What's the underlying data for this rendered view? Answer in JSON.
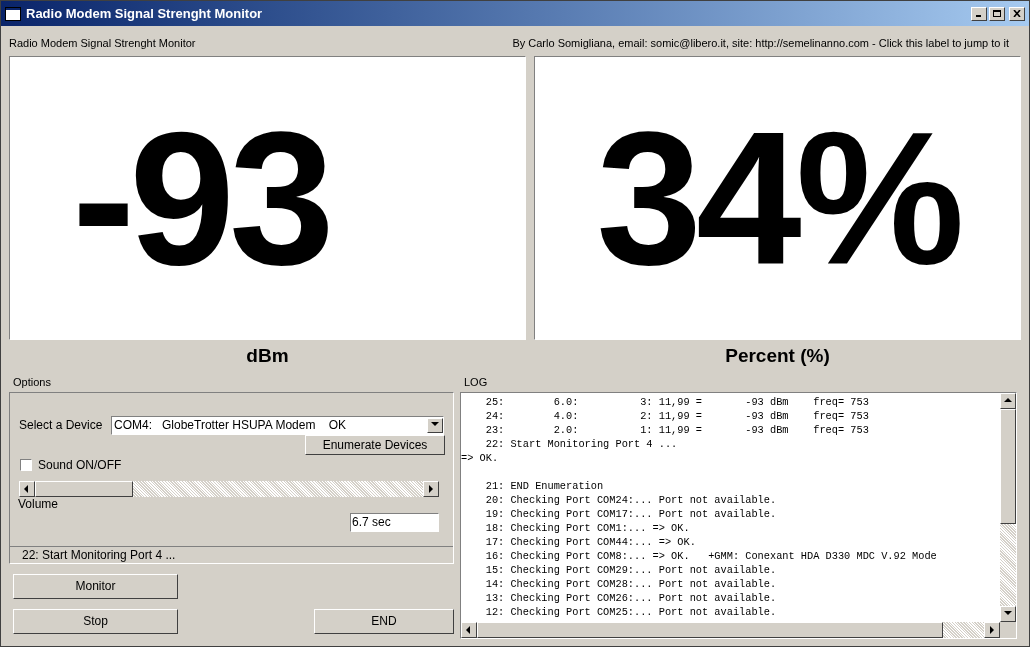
{
  "window": {
    "title": "Radio Modem Signal Strenght Monitor"
  },
  "header": {
    "app_label": "Radio Modem Signal Strenght Monitor",
    "credits_link": "By Carlo Somigliana, email: somic@libero.it, site: http://semelinanno.com - Click this label to jump to it"
  },
  "readouts": [
    {
      "value": "-93",
      "unit": "dBm"
    },
    {
      "value": "34%",
      "unit": "Percent (%)"
    }
  ],
  "options": {
    "title": "Options",
    "device_label": "Select a Device",
    "device_value": "COM4:   GlobeTrotter HSUPA Modem    OK",
    "enumerate_button": "Enumerate Devices",
    "sound": {
      "label": "Sound ON/OFF",
      "checked": false
    },
    "volume": {
      "label": "Volume",
      "level": 0
    },
    "interval": "6.7 sec",
    "status": "22: Start Monitoring Port 4 ..."
  },
  "buttons": {
    "monitor": "Monitor",
    "stop": "Stop",
    "end": "END"
  },
  "log": {
    "title": "LOG",
    "blocks": [
      [
        "    25:        6.0:          3: 11,99 =       -93 dBm    freq= 753",
        "    24:        4.0:          2: 11,99 =       -93 dBm    freq= 753",
        "    23:        2.0:          1: 11,99 =       -93 dBm    freq= 753",
        "    22: Start Monitoring Port 4 ...",
        "=> OK."
      ],
      [
        "    21: END Enumeration",
        "    20: Checking Port COM24:... Port not available.",
        "    19: Checking Port COM17:... Port not available.",
        "    18: Checking Port COM1:... => OK.",
        "    17: Checking Port COM44:... => OK.",
        "    16: Checking Port COM8:... => OK.   +GMM: Conexant HDA D330 MDC V.92 Mode",
        "    15: Checking Port COM29:... Port not available.",
        "    14: Checking Port COM28:... Port not available.",
        "    13: Checking Port COM26:... Port not available.",
        "    12: Checking Port COM25:... Port not available."
      ]
    ]
  }
}
